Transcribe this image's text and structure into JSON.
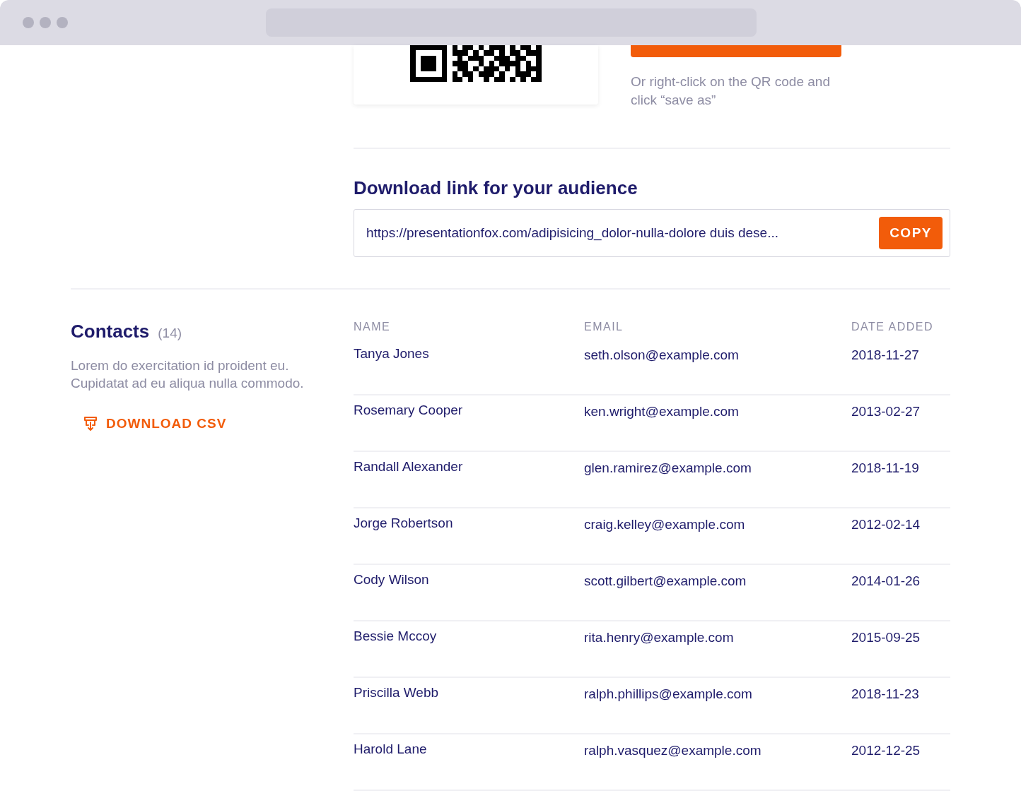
{
  "qr_section": {
    "hint": "Or right-click on the QR code and click “save as”"
  },
  "download_link": {
    "title": "Download link for your audience",
    "url": "https://presentationfox.com/adipisicing_dolor-nulla-dolore duis dese...",
    "button": "COPY"
  },
  "contacts": {
    "title": "Contacts",
    "count": "(14)",
    "description": "Lorem do exercitation id proident eu. Cupidatat ad eu aliqua nulla commodo.",
    "download": "DOWNLOAD CSV"
  },
  "table": {
    "columns": [
      "NAME",
      "EMAIL",
      "DATE ADDED"
    ],
    "rows": [
      {
        "name": "Tanya Jones",
        "email": "seth.olson@example.com",
        "date": "2018-11-27"
      },
      {
        "name": "Rosemary Cooper",
        "email": "ken.wright@example.com",
        "date": "2013-02-27"
      },
      {
        "name": "Randall Alexander",
        "email": "glen.ramirez@example.com",
        "date": "2018-11-19"
      },
      {
        "name": "Jorge Robertson",
        "email": "craig.kelley@example.com",
        "date": "2012-02-14"
      },
      {
        "name": "Cody Wilson",
        "email": "scott.gilbert@example.com",
        "date": "2014-01-26"
      },
      {
        "name": "Bessie Mccoy",
        "email": "rita.henry@example.com",
        "date": "2015-09-25"
      },
      {
        "name": "Priscilla Webb",
        "email": "ralph.phillips@example.com",
        "date": "2018-11-23"
      },
      {
        "name": "Harold Lane",
        "email": "ralph.vasquez@example.com",
        "date": "2012-12-25"
      }
    ]
  }
}
